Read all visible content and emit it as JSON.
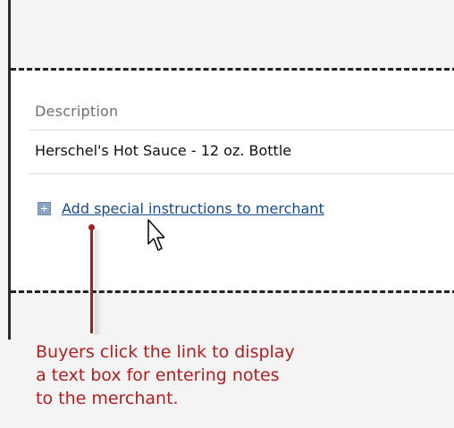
{
  "table": {
    "column_header": "Description",
    "row_description": "Herschel's Hot Sauce - 12 oz. Bottle"
  },
  "actions": {
    "add_instructions_link": "Add special instructions to merchant"
  },
  "annotation": {
    "lines": [
      "Buyers click the link to display",
      "a text box for entering notes",
      "to the merchant."
    ]
  },
  "colors": {
    "link": "#174a8d",
    "annotation": "#b11f1f",
    "plus_icon": "#8fa5c4"
  },
  "icons": {
    "expand": "plus-icon",
    "pointer": "mouse-cursor-icon",
    "pin": "annotation-pin-icon"
  }
}
